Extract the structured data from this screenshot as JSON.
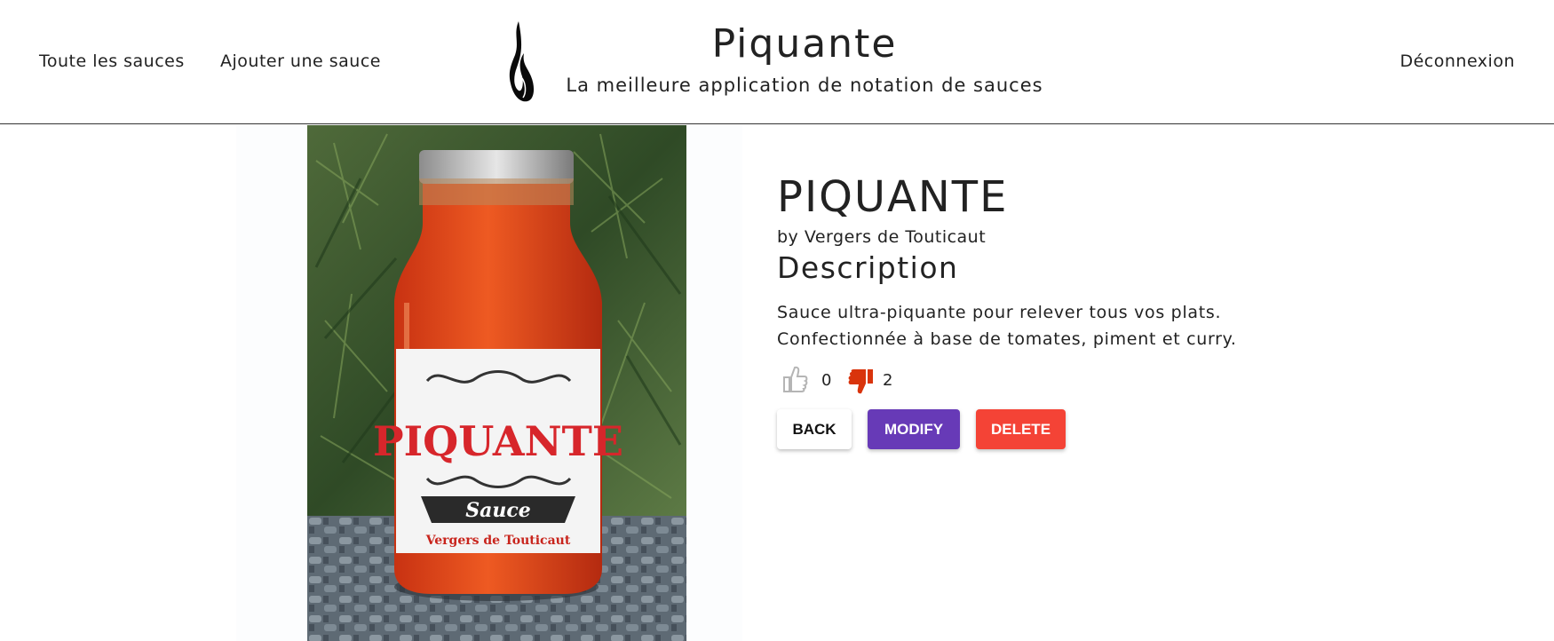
{
  "nav": {
    "all_sauces": "Toute les sauces",
    "add_sauce": "Ajouter une sauce",
    "logout": "Déconnexion"
  },
  "brand": {
    "title": "Piquante",
    "subtitle": "La meilleure application de notation de sauces"
  },
  "product_image": {
    "label_title": "PIQUANTE",
    "label_banner": "Sauce",
    "label_maker": "Vergers de Touticaut"
  },
  "sauce": {
    "name": "PIQUANTE",
    "manufacturer": "by Vergers de Touticaut",
    "description_heading": "Description",
    "description": "Sauce ultra-piquante pour relever tous vos plats. Confectionnée à base de tomates, piment et curry.",
    "likes": "0",
    "dislikes": "2"
  },
  "actions": {
    "back": "BACK",
    "modify": "MODIFY",
    "delete": "DELETE"
  },
  "colors": {
    "modify": "#673ab7",
    "delete": "#f44336",
    "dislike_active": "#d9340c",
    "like_inactive": "#b5b5b5"
  },
  "icons": [
    "flame-logo-icon",
    "thumbs-up-icon",
    "thumbs-down-icon"
  ]
}
